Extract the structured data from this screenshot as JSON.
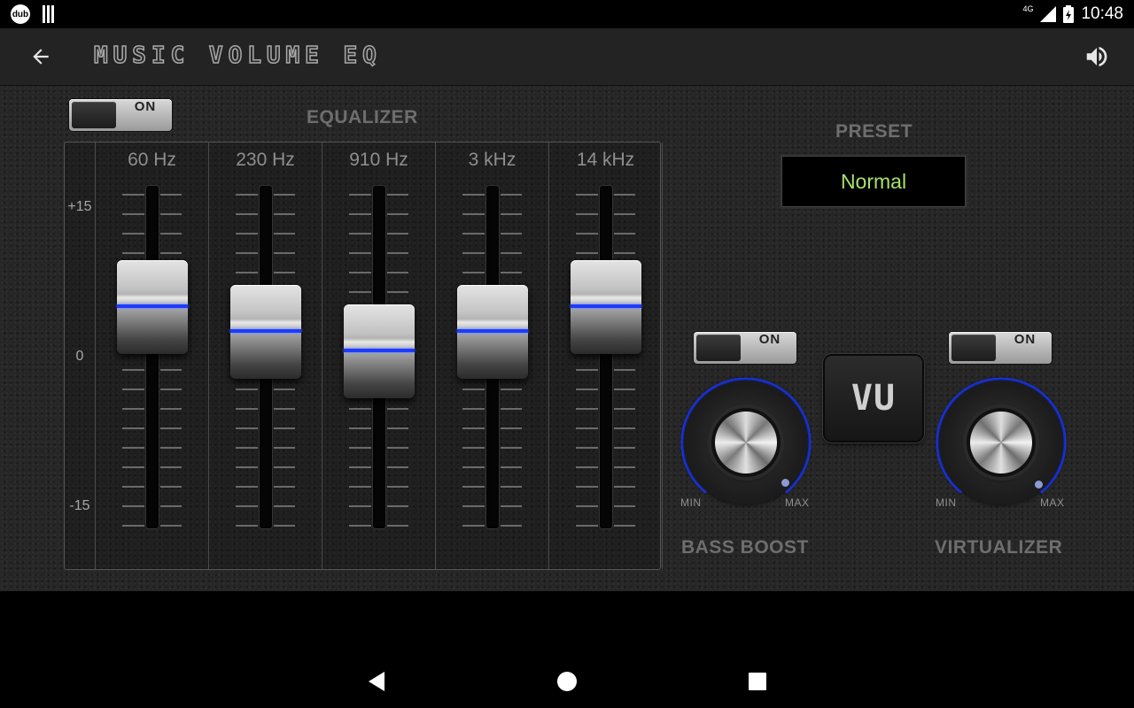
{
  "status_bar": {
    "app_badge": "dub",
    "network": "4G",
    "time": "10:48"
  },
  "app_bar": {
    "title": "MUSIC VOLUME EQ",
    "back_icon": "arrow-left-icon",
    "volume_icon": "speaker-volume-icon"
  },
  "equalizer": {
    "label": "EQUALIZER",
    "toggle_label": "ON",
    "scale": {
      "max": "+15",
      "mid": "0",
      "min": "-15"
    },
    "bands": [
      {
        "label": "60 Hz",
        "gain_db": 5
      },
      {
        "label": "230 Hz",
        "gain_db": 2.5
      },
      {
        "label": "910 Hz",
        "gain_db": 0.5
      },
      {
        "label": "3 kHz",
        "gain_db": 2.5
      },
      {
        "label": "14 kHz",
        "gain_db": 5
      }
    ]
  },
  "preset": {
    "label": "PRESET",
    "value": "Normal",
    "value_color": "#a7e26b"
  },
  "bass_boost": {
    "label": "BASS BOOST",
    "toggle_label": "ON",
    "min_label": "MIN",
    "max_label": "MAX",
    "level_fraction": 1.0
  },
  "vu_button": {
    "label": "VU"
  },
  "virtualizer": {
    "label": "VIRTUALIZER",
    "toggle_label": "ON",
    "min_label": "MIN",
    "max_label": "MAX",
    "level_fraction": 1.0
  },
  "colors": {
    "slider_indicator": "#1e3bff",
    "knob_arc": "#1e3bff"
  },
  "nav_bar": {
    "back_icon": "nav-back-triangle-icon",
    "home_icon": "nav-home-circle-icon",
    "recents_icon": "nav-recents-square-icon"
  }
}
